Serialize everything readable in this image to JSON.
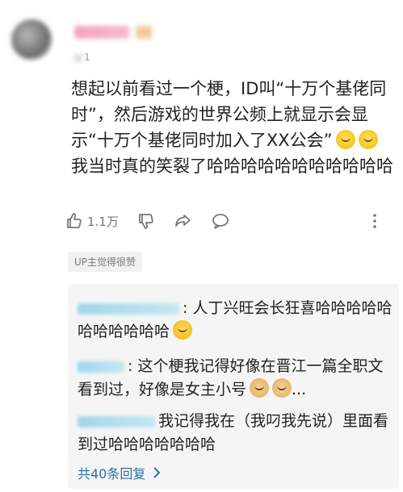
{
  "comment": {
    "level": "1",
    "text": "想起以前看过一个梗，ID叫“十万个基佬同时”，然后游戏的世界公频上就显示会显示“十万个基佬同时加入了XX公会”",
    "text_2": "我当时真的笑裂了哈哈哈哈哈哈哈哈哈哈哈",
    "like_count": "1.1万"
  },
  "up_liked": "UP主觉得很赞",
  "replies": [
    {
      "text": ": 人丁兴旺会长狂喜哈哈哈哈哈哈哈哈哈哈哈"
    },
    {
      "text": ": 这个梗我记得好像在晋江一篇全职文看到过，好像是女主小号",
      "suffix": "..."
    },
    {
      "text": "我记得我在（我叼我先说）里面看到过哈哈哈哈哈哈哈"
    }
  ],
  "view_all": "共40条回复",
  "icons": [
    "thumbs-up-icon",
    "thumbs-down-icon",
    "share-icon",
    "comment-icon",
    "more-icon",
    "chevron-right-icon"
  ]
}
